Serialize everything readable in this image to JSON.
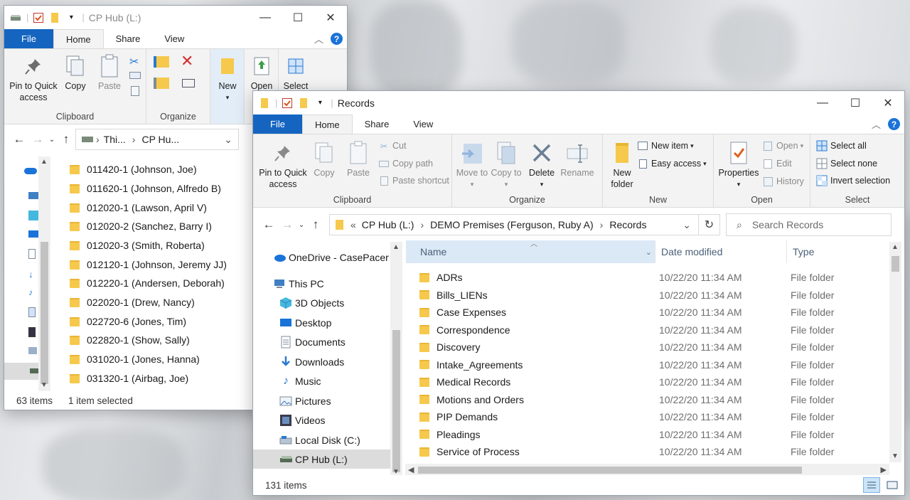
{
  "left_window": {
    "title": "CP Hub (L:)",
    "tabs": [
      "File",
      "Home",
      "Share",
      "View"
    ],
    "ribbon": {
      "pin_label": "Pin to Quick access",
      "copy_label": "Copy",
      "paste_label": "Paste",
      "clipboard_group": "Clipboard",
      "organize_group": "Organize",
      "new_label": "New",
      "open_label": "Open",
      "select_label": "Select"
    },
    "address": {
      "crumb1": "Thi...",
      "crumb2": "CP Hu..."
    },
    "items": [
      "011420-1 (Johnson, Joe)",
      "011620-1 (Johnson, Alfredo B)",
      "012020-1 (Lawson, April V)",
      "012020-2 (Sanchez, Barry I)",
      "012020-3 (Smith, Roberta)",
      "012120-1 (Johnson, Jeremy JJ)",
      "012220-1 (Andersen, Deborah)",
      "022020-1 (Drew, Nancy)",
      "022720-6 (Jones, Tim)",
      "022820-1 (Show, Sally)",
      "031020-1 (Jones, Hanna)",
      "031320-1 (Airbag, Joe)"
    ],
    "status": {
      "count": "63 items",
      "selected": "1 item selected"
    }
  },
  "right_window": {
    "title": "Records",
    "tabs": [
      "File",
      "Home",
      "Share",
      "View"
    ],
    "ribbon": {
      "pin_label": "Pin to Quick access",
      "copy_label": "Copy",
      "paste_label": "Paste",
      "cut_label": "Cut",
      "copy_path_label": "Copy path",
      "paste_shortcut_label": "Paste shortcut",
      "clipboard_group": "Clipboard",
      "move_to_label": "Move to",
      "copy_to_label": "Copy to",
      "delete_label": "Delete",
      "rename_label": "Rename",
      "organize_group": "Organize",
      "new_folder_label": "New folder",
      "new_item_label": "New item",
      "easy_access_label": "Easy access",
      "new_group": "New",
      "properties_label": "Properties",
      "open_label": "Open",
      "edit_label": "Edit",
      "history_label": "History",
      "open_group": "Open",
      "select_all_label": "Select all",
      "select_none_label": "Select none",
      "invert_selection_label": "Invert selection",
      "select_group": "Select"
    },
    "address": {
      "overflow": "«",
      "crumbs": [
        "CP Hub (L:)",
        "DEMO Premises (Ferguson, Ruby A)",
        "Records"
      ]
    },
    "search_placeholder": "Search Records",
    "nav": [
      {
        "label": "OneDrive - CasePacer",
        "icon": "cloud-icon"
      },
      {
        "label": "This PC",
        "icon": "computer-icon"
      },
      {
        "label": "3D Objects",
        "icon": "cube-icon"
      },
      {
        "label": "Desktop",
        "icon": "desktop-icon"
      },
      {
        "label": "Documents",
        "icon": "documents-icon"
      },
      {
        "label": "Downloads",
        "icon": "download-icon"
      },
      {
        "label": "Music",
        "icon": "music-icon"
      },
      {
        "label": "Pictures",
        "icon": "pictures-icon"
      },
      {
        "label": "Videos",
        "icon": "videos-icon"
      },
      {
        "label": "Local Disk (C:)",
        "icon": "disk-icon"
      },
      {
        "label": "CP Hub (L:)",
        "icon": "network-drive-icon"
      }
    ],
    "columns": {
      "name": "Name",
      "date": "Date modified",
      "type": "Type"
    },
    "rows": [
      {
        "name": "ADRs",
        "date": "10/22/20 11:34 AM",
        "type": "File folder"
      },
      {
        "name": "Bills_LIENs",
        "date": "10/22/20 11:34 AM",
        "type": "File folder"
      },
      {
        "name": "Case Expenses",
        "date": "10/22/20 11:34 AM",
        "type": "File folder"
      },
      {
        "name": "Correspondence",
        "date": "10/22/20 11:34 AM",
        "type": "File folder"
      },
      {
        "name": "Discovery",
        "date": "10/22/20 11:34 AM",
        "type": "File folder"
      },
      {
        "name": "Intake_Agreements",
        "date": "10/22/20 11:34 AM",
        "type": "File folder"
      },
      {
        "name": "Medical Records",
        "date": "10/22/20 11:34 AM",
        "type": "File folder"
      },
      {
        "name": "Motions and Orders",
        "date": "10/22/20 11:34 AM",
        "type": "File folder"
      },
      {
        "name": "PIP Demands",
        "date": "10/22/20 11:34 AM",
        "type": "File folder"
      },
      {
        "name": "Pleadings",
        "date": "10/22/20 11:34 AM",
        "type": "File folder"
      },
      {
        "name": "Service of Process",
        "date": "10/22/20 11:34 AM",
        "type": "File folder"
      }
    ],
    "status": {
      "count": "131 items"
    }
  }
}
